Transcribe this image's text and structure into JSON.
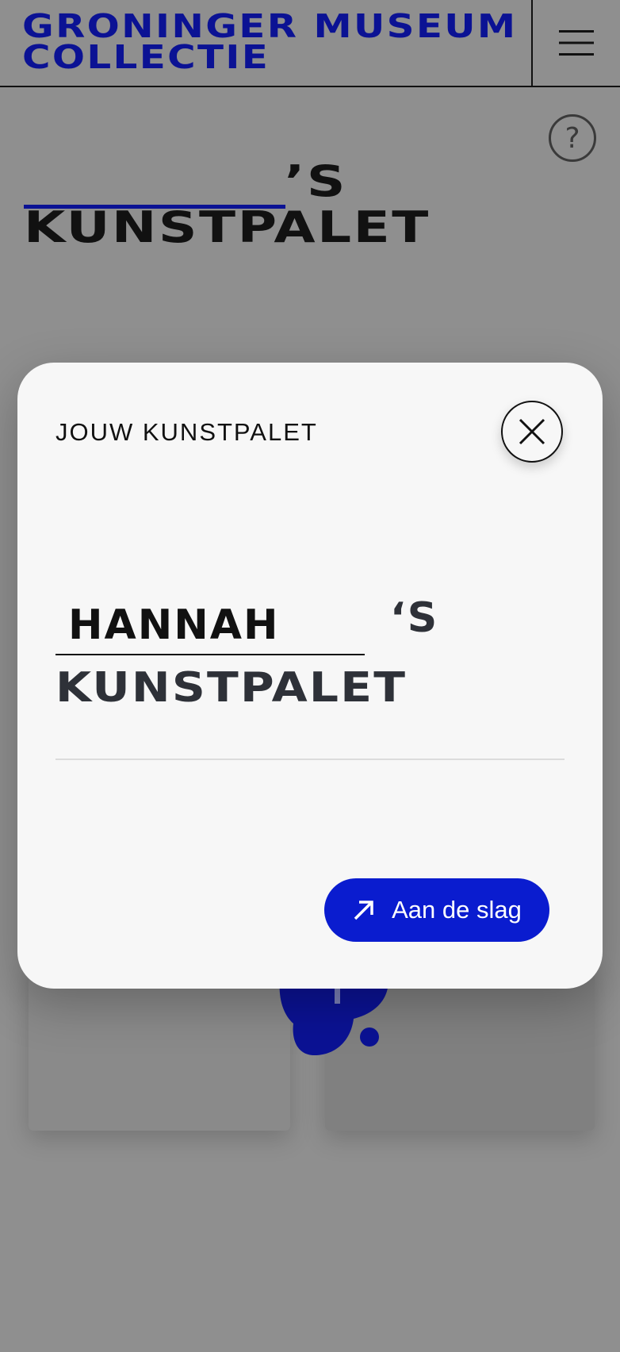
{
  "header": {
    "brand_line1": "GRONINGER MUSEUM",
    "brand_line2": "COLLECTIE",
    "menu_icon": "hamburger-icon"
  },
  "page": {
    "help_symbol": "?",
    "title_suffix": "’S",
    "title_line2": "KUNSTPALET"
  },
  "modal": {
    "label": "JOUW KUNSTPALET",
    "close_icon": "close-icon",
    "name_value": "HANNAH",
    "name_suffix": "‘S",
    "subtitle": "KUNSTPALET",
    "cta_label": "Aan de slag",
    "cta_icon": "arrow-up-right-icon"
  },
  "colors": {
    "brand_blue": "#0b1294",
    "cta_blue": "#0a1ccf",
    "overlay": "#8f8f8f",
    "modal_bg": "#f7f7f7"
  }
}
